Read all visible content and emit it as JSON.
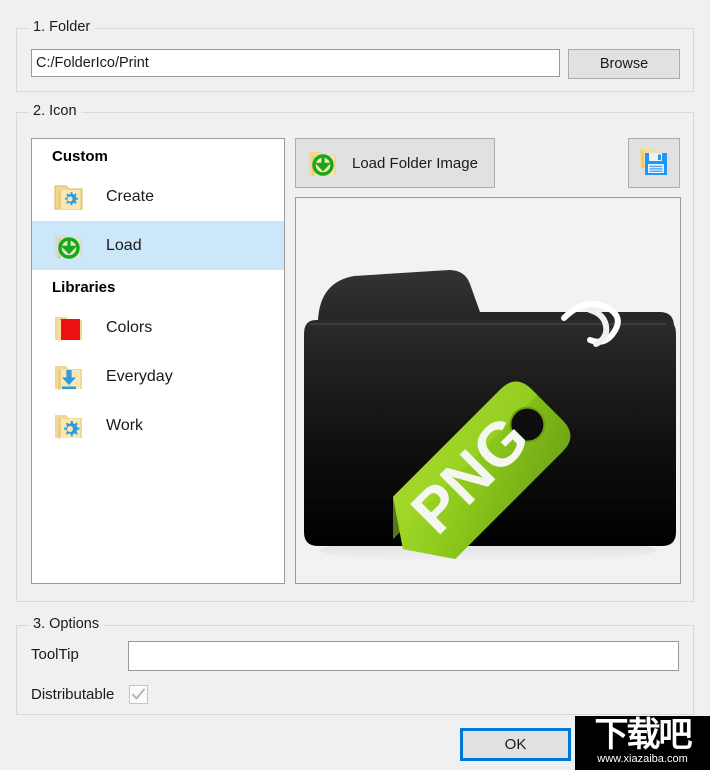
{
  "folder_group": {
    "title": "1. Folder",
    "path_value": "C:/FolderIco/Print",
    "path_placeholder": "",
    "browse_label": "Browse"
  },
  "icon_group": {
    "title": "2. Icon",
    "load_folder_image_label": "Load Folder Image",
    "save_icon_name": "save-floppy-icon",
    "list": {
      "sections": [
        {
          "header": "Custom",
          "items": [
            {
              "label": "Create",
              "icon": "folder-gear-icon",
              "selected": false
            },
            {
              "label": "Load",
              "icon": "folder-download-icon",
              "selected": true
            }
          ]
        },
        {
          "header": "Libraries",
          "items": [
            {
              "label": "Colors",
              "icon": "folder-red-icon",
              "selected": false
            },
            {
              "label": "Everyday",
              "icon": "folder-arrow-icon",
              "selected": false
            },
            {
              "label": "Work",
              "icon": "folder-gear-blue-icon",
              "selected": false
            }
          ]
        }
      ]
    },
    "preview": {
      "icon_name": "black-folder-png-tag-preview",
      "tag_text": "PNG",
      "folder_color": "#0d0d0d",
      "tag_color": "#8cc81b",
      "background": "#f2f2f2"
    }
  },
  "options_group": {
    "title": "3. Options",
    "tooltip_label": "ToolTip",
    "tooltip_value": "",
    "tooltip_placeholder": "",
    "distributable_label": "Distributable",
    "distributable_checked": true,
    "distributable_disabled": true
  },
  "footer": {
    "ok_label": "OK",
    "focus_color": "#0078d7"
  },
  "watermark": {
    "cn_text": "下载吧",
    "url_text": "www.xiazaiba.com"
  }
}
